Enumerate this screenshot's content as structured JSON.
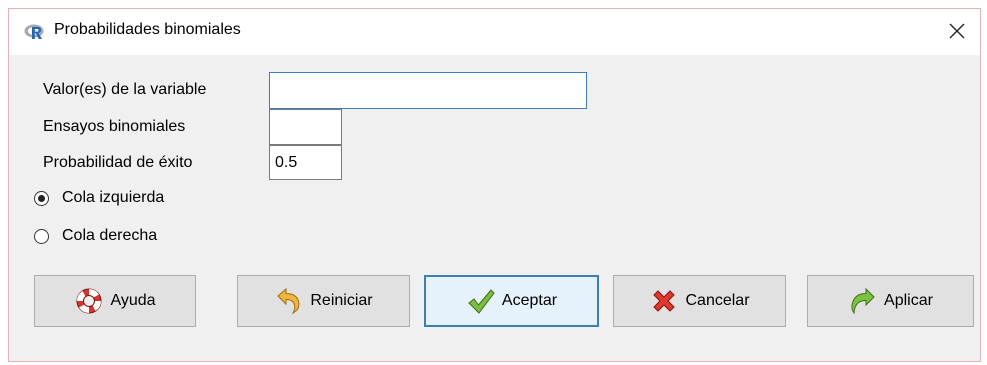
{
  "window": {
    "title": "Probabilidades binomiales",
    "app_icon": "r-logo-icon",
    "close_icon": "close-icon"
  },
  "fields": {
    "variable_values": {
      "label": "Valor(es) de la variable",
      "value": ""
    },
    "binomial_trials": {
      "label": "Ensayos binomiales",
      "value": ""
    },
    "success_probability": {
      "label": "Probabilidad de éxito",
      "value": "0.5"
    }
  },
  "tail": {
    "options": [
      {
        "label": "Cola izquierda",
        "checked": true
      },
      {
        "label": "Cola derecha",
        "checked": false
      }
    ]
  },
  "buttons": {
    "help": {
      "label": "Ayuda",
      "icon": "lifebuoy-icon"
    },
    "reset": {
      "label": "Reiniciar",
      "icon": "undo-arrow-icon"
    },
    "ok": {
      "label": "Aceptar",
      "icon": "checkmark-icon"
    },
    "cancel": {
      "label": "Cancelar",
      "icon": "red-x-icon"
    },
    "apply": {
      "label": "Aplicar",
      "icon": "redo-arrow-icon"
    }
  },
  "colors": {
    "window_border": "#e3b3b8",
    "focus_border": "#3e7cc4",
    "default_button_border": "#3c7fb1",
    "background": "#f0f0f0"
  }
}
